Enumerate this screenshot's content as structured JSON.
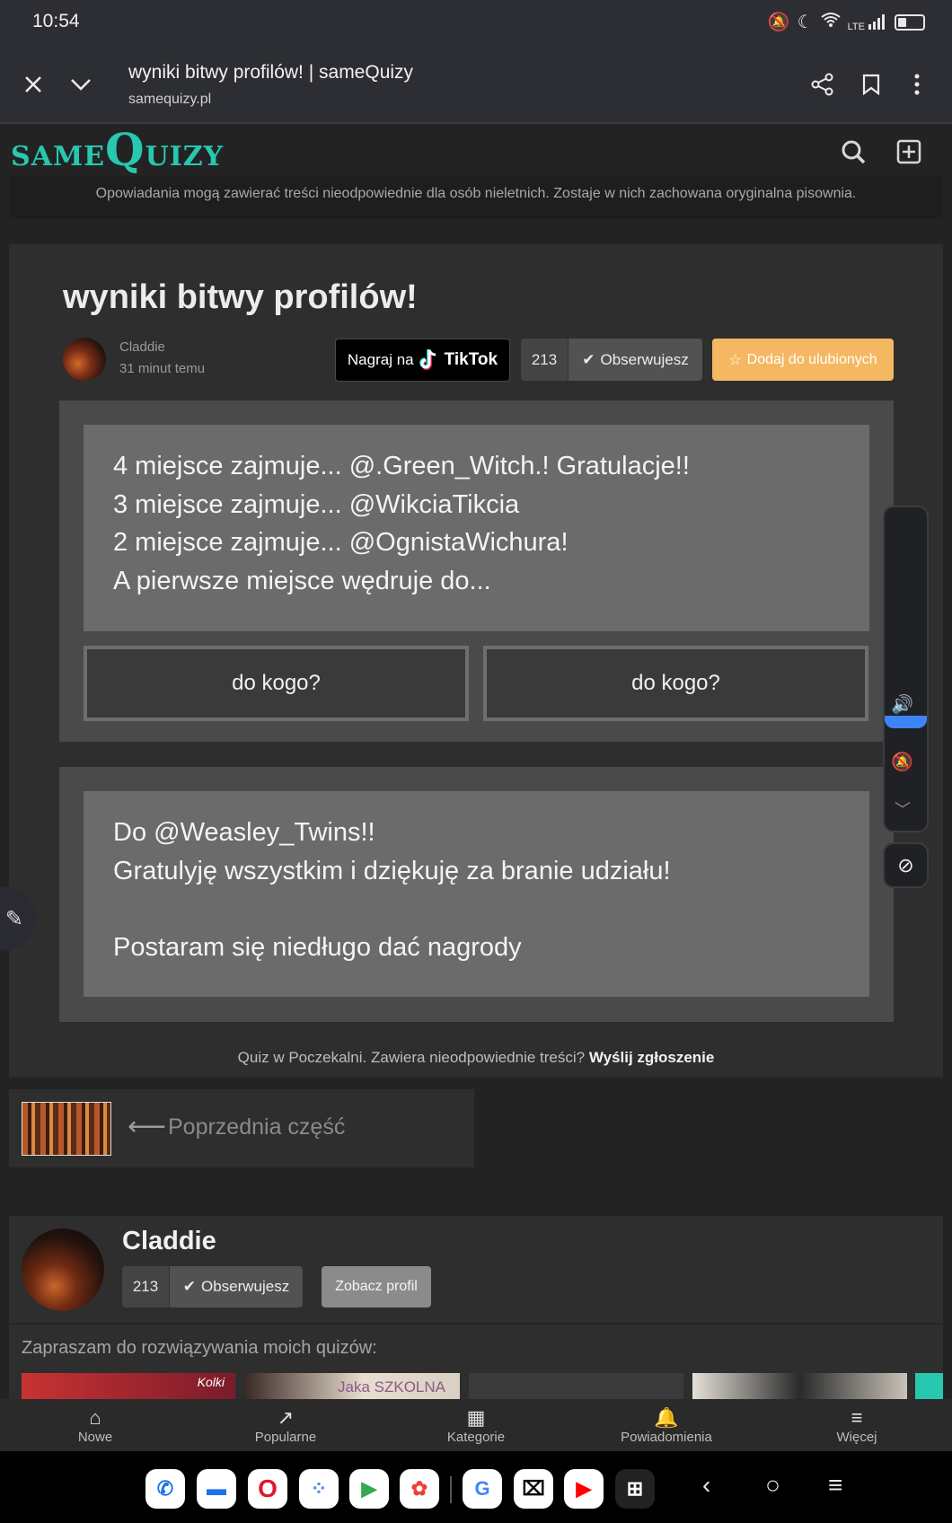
{
  "status_bar": {
    "time": "10:54",
    "network": "LTE"
  },
  "browser": {
    "page_title": "wyniki bitwy profilów! | sameQuizy",
    "url": "samequizy.pl"
  },
  "site": {
    "logo_small": "SAME",
    "logo_big": "Q",
    "logo_rest": "UIZY",
    "notice": "Opowiadania mogą zawierać treści nieodpowiednie dla osób nieletnich. Zostaje w nich zachowana oryginalna pisownia."
  },
  "quiz": {
    "title": "wyniki bitwy profilów!",
    "author": "Claddie",
    "time_ago": "31 minut temu",
    "tiktok_prefix": "Nagraj na",
    "tiktok_brand": "TikTok",
    "followers": "213",
    "follow_label": "Obserwujesz",
    "favorite_label": "Dodaj do ulubionych",
    "question1_lines": [
      "4 miejsce zajmuje... @.Green_Witch.! Gratulacje!!",
      "3 miejsce zajmuje... @WikciaTikcia",
      "2 miejsce zajmuje... @OgnistaWichura!",
      "A pierwsze miejsce wędruje do..."
    ],
    "answers": [
      "do kogo?",
      "do kogo?"
    ],
    "result_lines": [
      "Do @Weasley_Twins!!",
      "Gratulyję wszystkim i dziękuję za branie udziału!",
      "",
      "Postaram się niedługo dać nagrody"
    ],
    "report_text": "Quiz w Poczekalni. Zawiera nieodpowiednie treści?",
    "report_link": "Wyślij zgłoszenie"
  },
  "prev_part": {
    "label": "Poprzednia część"
  },
  "author_card": {
    "name": "Claddie",
    "followers": "213",
    "follow_label": "Obserwujesz",
    "profile_label": "Zobacz profil",
    "invite": "Zapraszam do rozwiązywania moich quizów:",
    "thumb_texts": [
      "Kolki",
      "Jaka SZKOLNA"
    ]
  },
  "bottom_nav": [
    {
      "label": "Nowe",
      "icon": "home-icon"
    },
    {
      "label": "Popularne",
      "icon": "trending-icon"
    },
    {
      "label": "Kategorie",
      "icon": "grid-icon"
    },
    {
      "label": "Powiadomienia",
      "icon": "bell-icon"
    },
    {
      "label": "Więcej",
      "icon": "menu-icon"
    }
  ],
  "colors": {
    "accent": "#28c7b0",
    "favorite": "#f5b862",
    "volume": "#3d84f6"
  }
}
